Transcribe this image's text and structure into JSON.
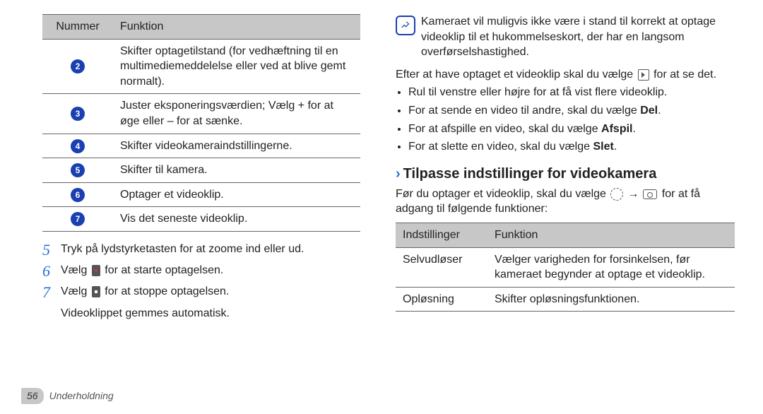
{
  "left_table": {
    "headers": [
      "Nummer",
      "Funktion"
    ],
    "rows": [
      {
        "num": "2",
        "func": "Skifter optagetilstand (for vedhæftning til en multimediemeddelelse eller ved at blive gemt normalt)."
      },
      {
        "num": "3",
        "func": "Juster eksponeringsværdien; Vælg + for at øge eller – for at sænke."
      },
      {
        "num": "4",
        "func": "Skifter videokameraindstillingerne."
      },
      {
        "num": "5",
        "func": "Skifter til kamera."
      },
      {
        "num": "6",
        "func": "Optager et videoklip."
      },
      {
        "num": "7",
        "func": "Vis det seneste videoklip."
      }
    ]
  },
  "steps": {
    "s5": "Tryk på lydstyrketasten for at zoome ind eller ud.",
    "s6a": "Vælg ",
    "s6b": " for at starte optagelsen.",
    "s7a": "Vælg ",
    "s7b": " for at stoppe optagelsen.",
    "s7sub": "Videoklippet gemmes automatisk."
  },
  "note": "Kameraet vil muligvis ikke være i stand til korrekt at optage videoklip til et hukommelseskort, der har en langsom overførselshastighed.",
  "after_note_a": "Efter at have optaget et videoklip skal du vælge ",
  "after_note_b": " for at se det.",
  "bullets": [
    "Rul til venstre eller højre for at få vist flere videoklip.",
    "For at sende en video til andre, skal du vælge Del.",
    "For at afspille en video, skal du vælge Afspil.",
    "For at slette en video, skal du vælge Slet."
  ],
  "section_heading": "Tilpasse indstillinger for videokamera",
  "section_intro_a": "Før du optager et videoklip, skal du vælge ",
  "section_intro_b": " for at få adgang til følgende funktioner:",
  "right_table": {
    "headers": [
      "Indstillinger",
      "Funktion"
    ],
    "rows": [
      {
        "k": "Selvudløser",
        "v": "Vælger varigheden for forsinkelsen, før kameraet begynder at optage et videoklip."
      },
      {
        "k": "Opløsning",
        "v": "Skifter opløsningsfunktionen."
      }
    ]
  },
  "footer": {
    "page": "56",
    "section": "Underholdning"
  }
}
